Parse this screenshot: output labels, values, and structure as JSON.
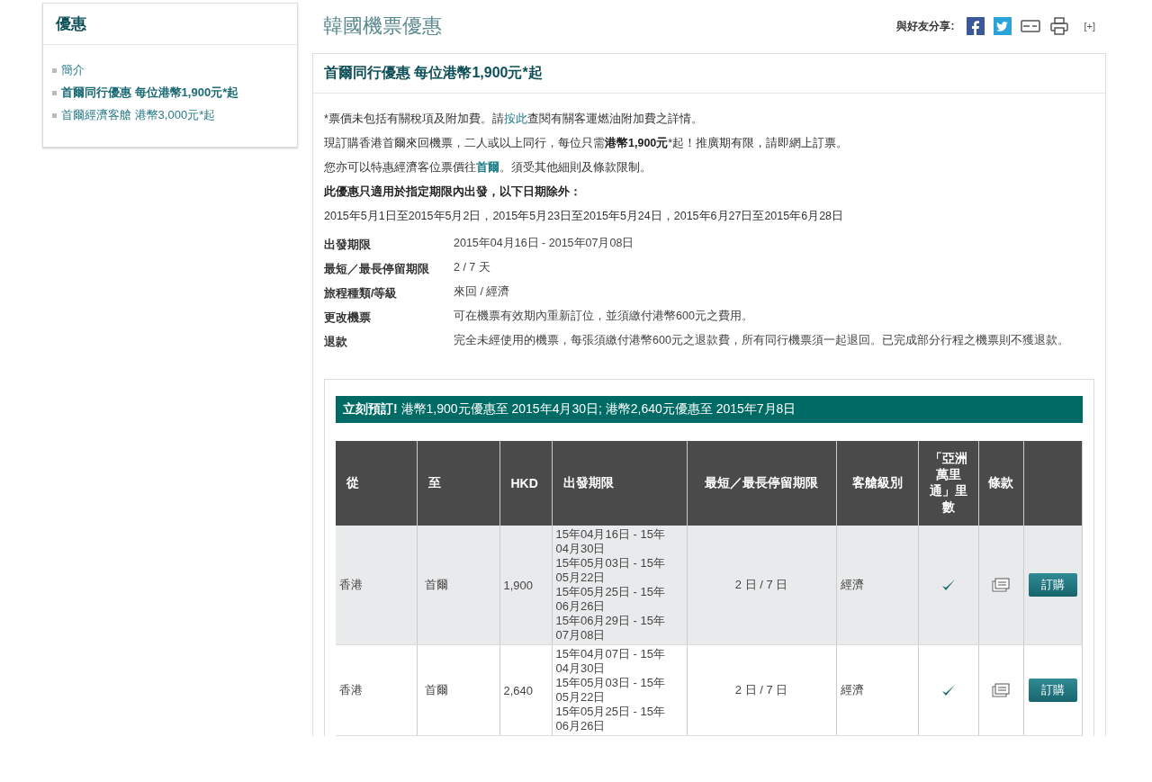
{
  "sidebar": {
    "title": "優惠",
    "items": [
      {
        "label": "簡介",
        "selected": false
      },
      {
        "label": "首爾同行優惠 每位港幣1,900元*起",
        "selected": true
      },
      {
        "label": "首爾經濟客艙 港幣3,000元*起",
        "selected": false
      }
    ]
  },
  "page_title": "韓國機票優惠",
  "share": {
    "label": "與好友分享:",
    "more": "[+]"
  },
  "offer": {
    "title": "首爾同行優惠 每位港幣1,900元*起",
    "note": {
      "before": "*票價未包括有關稅項及附加費。請",
      "link": "按此",
      "after": "查閱有關客運燃油附加費之詳情。"
    },
    "paragraphs": [
      "現訂購香港首爾來回機票，二人或以上同行，每位只需**港幣1,900元***起！推廣期有限，請即網上訂票。",
      "您亦可以特惠經濟客位票價往**首爾**。須受其他細則及條款限制。"
    ],
    "exclusion_heading": "此優惠只適用於指定期限內出發，以下日期除外：",
    "exclusion_dates": "2015年5月1日至2015年5月2日，2015年5月23日至2015年5月24日，2015年6月27日至2015年6月28日",
    "details": [
      {
        "label": "出發期限",
        "value": "2015年04月16日 - 2015年07月08日"
      },
      {
        "label": "最短／最長停留期限",
        "value": "2 / 7 天"
      },
      {
        "label": "旅程種類/等級",
        "value": "來回 / 經濟"
      },
      {
        "label": "更改機票",
        "value": "可在機票有效期內重新訂位，並須繳付港幣600元之費用。"
      },
      {
        "label": "退款",
        "value": "完全未經使用的機票，每張須繳付港幣600元之退款費，所有同行機票須一起退回。已完成部分行程之機票則不獲退款。"
      }
    ],
    "banner": "**立刻預訂!** 港幣1,900元優惠至 2015年4月30日; 港幣2,640元優惠至 2015年7月8日",
    "table": {
      "columns": [
        "從",
        "至",
        "HKD",
        "出發期限",
        "最短／最長停留期限",
        "客艙級別",
        "「亞洲萬里通」里數",
        "條款"
      ],
      "rows": [
        {
          "from": "香港",
          "to": "首爾",
          "price": "1,900",
          "periods": [
            "15年04月16日 - 15年04月30日",
            "15年05月03日 - 15年05月22日",
            "15年05月25日 - 15年06月26日",
            "15年06月29日 - 15年07月08日"
          ],
          "stay": "2 日 / 7 日",
          "cabin": "經濟",
          "miles": true,
          "button": "訂購"
        },
        {
          "from": "香港",
          "to": "首爾",
          "price": "2,640",
          "periods": [
            "15年04月07日 - 15年04月30日",
            "15年05月03日 - 15年05月22日",
            "15年05月25日 - 15年06月26日"
          ],
          "stay": "2 日 / 7 日",
          "cabin": "經濟",
          "miles": true,
          "button": "訂購"
        }
      ]
    }
  }
}
